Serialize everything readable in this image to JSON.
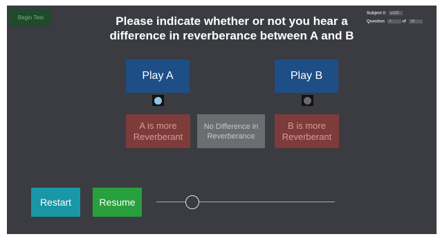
{
  "top": {
    "begin_label": "Begin Test",
    "title_line1": "Please indicate whether or not you hear a",
    "title_line2": "difference in reverberance between A and B",
    "subject_label": "Subject #:",
    "subject_value": "▸122",
    "question_label": "Question",
    "question_number": "1",
    "of_label": "of",
    "question_total": "10"
  },
  "players": {
    "play_a_label": "Play A",
    "play_b_label": "Play B",
    "indicator_a": "on",
    "indicator_b": "off"
  },
  "choices": {
    "a_line1": "A is more",
    "a_line2": "Reverberant",
    "none_line1": "No Difference in",
    "none_line2": "Reverberance",
    "b_line1": "B is more",
    "b_line2": "Reverberant"
  },
  "controls": {
    "restart_label": "Restart",
    "resume_label": "Resume",
    "progress_fraction": 0.2
  },
  "colors": {
    "background": "#3a3c42",
    "play_button": "#1e4e86",
    "choice_button": "#7d3b3a",
    "neutral_button": "#6b6d70",
    "restart_button": "#1a97a6",
    "resume_button": "#27a03d",
    "indicator_active": "#8fc7ec"
  }
}
